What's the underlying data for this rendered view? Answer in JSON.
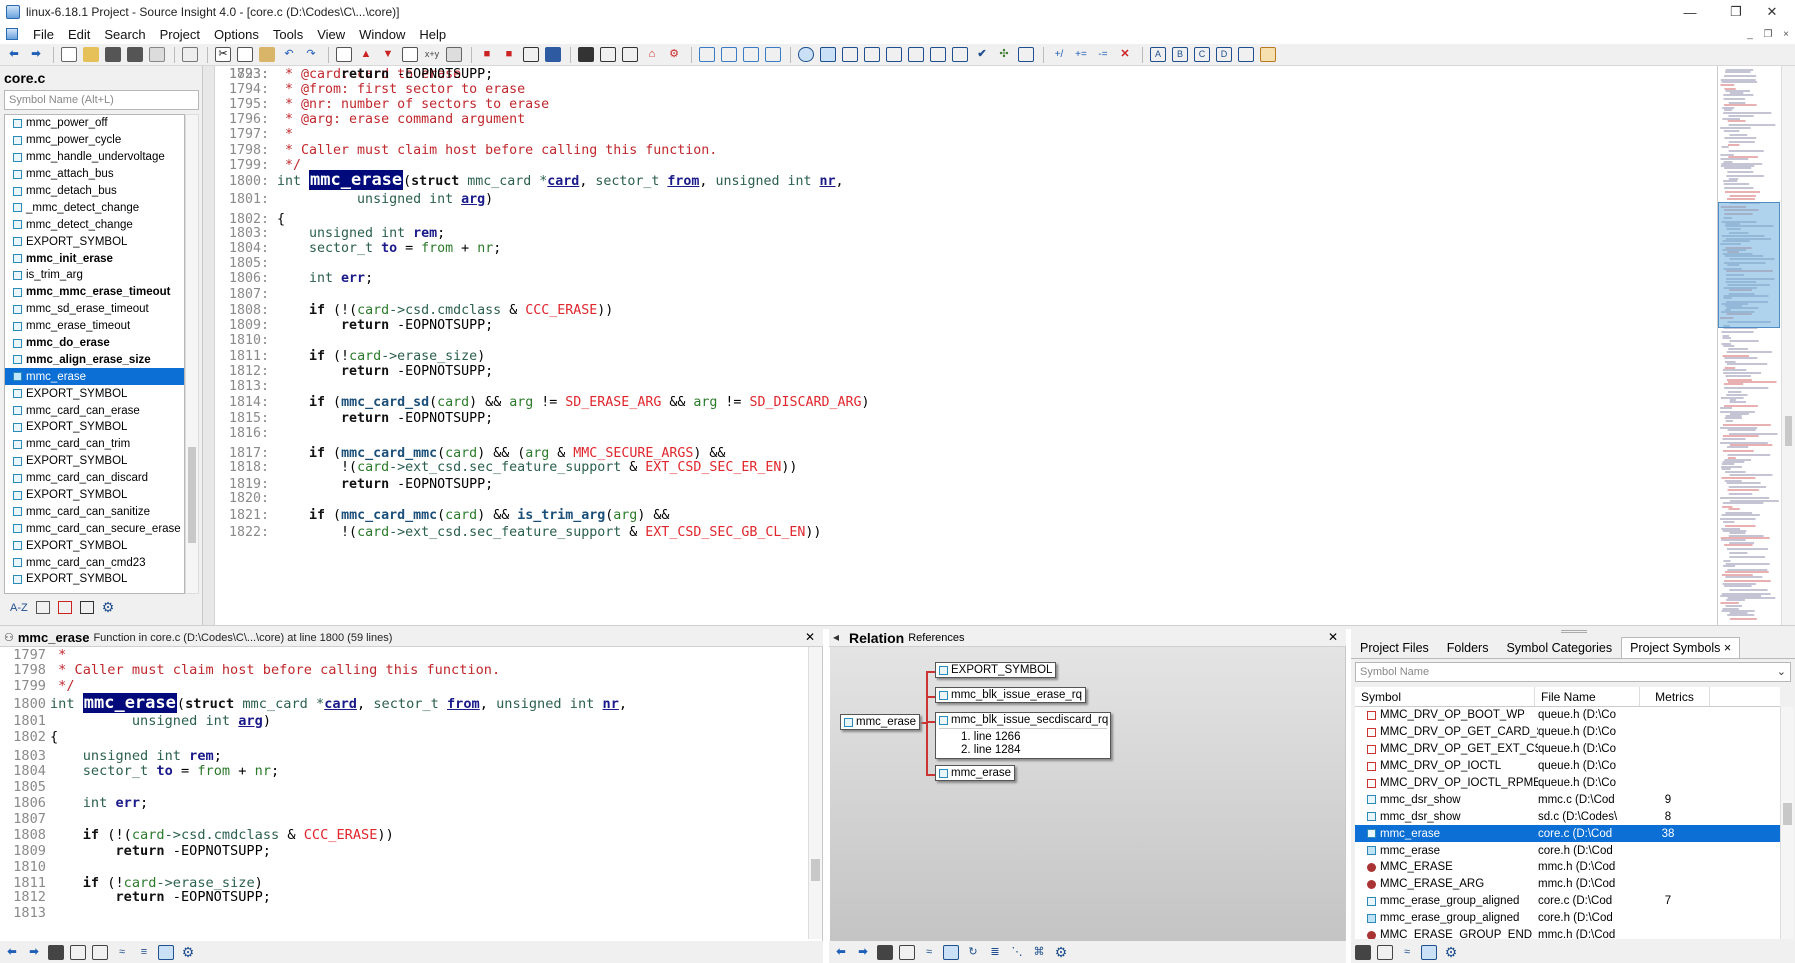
{
  "window": {
    "title": "linux-6.18.1 Project - Source Insight 4.0 - [core.c (D:\\Codes\\C\\...\\core)]",
    "minimize": "—",
    "restore": "❐",
    "close": "✕"
  },
  "menu": [
    "File",
    "Edit",
    "Search",
    "Project",
    "Options",
    "Tools",
    "View",
    "Window",
    "Help"
  ],
  "menu_right": [
    "_",
    "❐",
    "×"
  ],
  "symbol_panel": {
    "file": "core.c",
    "search_placeholder": "Symbol Name (Alt+L)",
    "items": [
      {
        "label": "mmc_power_off",
        "bold": false
      },
      {
        "label": "mmc_power_cycle",
        "bold": false
      },
      {
        "label": "mmc_handle_undervoltage",
        "bold": false
      },
      {
        "label": "mmc_attach_bus",
        "bold": false
      },
      {
        "label": "mmc_detach_bus",
        "bold": false
      },
      {
        "label": "_mmc_detect_change",
        "bold": false
      },
      {
        "label": "mmc_detect_change",
        "bold": false
      },
      {
        "label": "EXPORT_SYMBOL",
        "bold": false
      },
      {
        "label": "mmc_init_erase",
        "bold": true
      },
      {
        "label": "is_trim_arg",
        "bold": false
      },
      {
        "label": "mmc_mmc_erase_timeout",
        "bold": true
      },
      {
        "label": "mmc_sd_erase_timeout",
        "bold": false
      },
      {
        "label": "mmc_erase_timeout",
        "bold": false
      },
      {
        "label": "mmc_do_erase",
        "bold": true
      },
      {
        "label": "mmc_align_erase_size",
        "bold": true
      },
      {
        "label": "mmc_erase",
        "bold": false,
        "selected": true
      },
      {
        "label": "EXPORT_SYMBOL",
        "bold": false
      },
      {
        "label": "mmc_card_can_erase",
        "bold": false
      },
      {
        "label": "EXPORT_SYMBOL",
        "bold": false
      },
      {
        "label": "mmc_card_can_trim",
        "bold": false
      },
      {
        "label": "EXPORT_SYMBOL",
        "bold": false
      },
      {
        "label": "mmc_card_can_discard",
        "bold": false
      },
      {
        "label": "EXPORT_SYMBOL",
        "bold": false
      },
      {
        "label": "mmc_card_can_sanitize",
        "bold": false
      },
      {
        "label": "mmc_card_can_secure_erase",
        "bold": false
      },
      {
        "label": "EXPORT_SYMBOL",
        "bold": false
      },
      {
        "label": "mmc_card_can_cmd23",
        "bold": false
      },
      {
        "label": "EXPORT_SYMBOL",
        "bold": false
      }
    ],
    "footer_icons": [
      "sort-az-icon",
      "list-icon",
      "category-icon",
      "book-icon",
      "gear-icon"
    ]
  },
  "editor": {
    "lines": [
      {
        "n": "1793:",
        "segs": [
          [
            "cm",
            " * @card: card to erase"
          ]
        ]
      },
      {
        "n": "1794:",
        "segs": [
          [
            "cm",
            " * @from: first sector to erase"
          ]
        ]
      },
      {
        "n": "1795:",
        "segs": [
          [
            "cm",
            " * @nr: number of sectors to erase"
          ]
        ]
      },
      {
        "n": "1796:",
        "segs": [
          [
            "cm",
            " * @arg: erase command argument"
          ]
        ]
      },
      {
        "n": "1797:",
        "segs": [
          [
            "cm",
            " *"
          ]
        ]
      },
      {
        "n": "1798:",
        "segs": [
          [
            "cm",
            " * Caller must claim host before calling this function."
          ]
        ]
      },
      {
        "n": "1799:",
        "segs": [
          [
            "cm",
            " */"
          ]
        ]
      },
      {
        "n": "1800:",
        "segs": [
          [
            "ty",
            "int "
          ],
          [
            "hl",
            "mmc_erase"
          ],
          [
            "",
            "("
          ],
          [
            "kw",
            "struct"
          ],
          [
            "ty",
            " mmc_card *"
          ],
          [
            "pn",
            "card"
          ],
          [
            "",
            ", "
          ],
          [
            "ty",
            "sector_t "
          ],
          [
            "pn",
            "from"
          ],
          [
            "",
            ", "
          ],
          [
            "ty",
            "unsigned int "
          ],
          [
            "pn",
            "nr"
          ],
          [
            "",
            ","
          ]
        ]
      },
      {
        "n": "1801:",
        "segs": [
          [
            "ty",
            "          unsigned int "
          ],
          [
            "pn",
            "arg"
          ],
          [
            "",
            ")"
          ]
        ]
      },
      {
        "n": "1802:",
        "segs": [
          [
            "",
            "{"
          ]
        ]
      },
      {
        "n": "1803:",
        "segs": [
          [
            "ty",
            "    unsigned int "
          ],
          [
            "vn",
            "rem"
          ],
          [
            "",
            ";"
          ]
        ]
      },
      {
        "n": "1804:",
        "segs": [
          [
            "ty",
            "    sector_t "
          ],
          [
            "vn",
            "to"
          ],
          [
            "",
            " = "
          ],
          [
            "gv",
            "from"
          ],
          [
            "",
            " + "
          ],
          [
            "gv",
            "nr"
          ],
          [
            "",
            ";"
          ]
        ]
      },
      {
        "n": "1805:",
        "segs": [
          [
            "",
            ""
          ]
        ]
      },
      {
        "n": "1806:",
        "segs": [
          [
            "ty",
            "    int "
          ],
          [
            "vn",
            "err"
          ],
          [
            "",
            ";"
          ]
        ]
      },
      {
        "n": "1807:",
        "segs": [
          [
            "",
            ""
          ]
        ]
      },
      {
        "n": "1808:",
        "segs": [
          [
            "kw",
            "    if"
          ],
          [
            "",
            " (!("
          ],
          [
            "gv",
            "card"
          ],
          [
            "ty",
            "->csd.cmdclass"
          ],
          [
            "",
            " & "
          ],
          [
            "rd",
            "CCC_ERASE"
          ],
          [
            "",
            "))"
          ]
        ]
      },
      {
        "n": "1809:",
        "segs": [
          [
            "kw",
            "        return"
          ],
          [
            "",
            " -EOPNOTSUPP;"
          ]
        ]
      },
      {
        "n": "1810:",
        "segs": [
          [
            "",
            ""
          ]
        ]
      },
      {
        "n": "1811:",
        "segs": [
          [
            "kw",
            "    if"
          ],
          [
            "",
            " (!"
          ],
          [
            "gv",
            "card"
          ],
          [
            "ty",
            "->erase_size"
          ],
          [
            "",
            ")"
          ]
        ]
      },
      {
        "n": "1812:",
        "segs": [
          [
            "kw",
            "        return"
          ],
          [
            "",
            " -EOPNOTSUPP;"
          ]
        ]
      },
      {
        "n": "1813:",
        "segs": [
          [
            "",
            ""
          ]
        ]
      },
      {
        "n": "1814:",
        "segs": [
          [
            "kw",
            "    if"
          ],
          [
            "",
            " ("
          ],
          [
            "fn",
            "mmc_card_sd"
          ],
          [
            "",
            "("
          ],
          [
            "gv",
            "card"
          ],
          [
            "",
            ") && "
          ],
          [
            "gv",
            "arg"
          ],
          [
            "",
            " != "
          ],
          [
            "rd",
            "SD_ERASE_ARG"
          ],
          [
            "",
            " && "
          ],
          [
            "gv",
            "arg"
          ],
          [
            "",
            " != "
          ],
          [
            "rd",
            "SD_DISCARD_ARG"
          ],
          [
            "",
            ")"
          ]
        ]
      },
      {
        "n": "1815:",
        "segs": [
          [
            "kw",
            "        return"
          ],
          [
            "",
            " -EOPNOTSUPP;"
          ]
        ]
      },
      {
        "n": "1816:",
        "segs": [
          [
            "",
            ""
          ]
        ]
      },
      {
        "n": "1817:",
        "segs": [
          [
            "kw",
            "    if"
          ],
          [
            "",
            " ("
          ],
          [
            "fn",
            "mmc_card_mmc"
          ],
          [
            "",
            "("
          ],
          [
            "gv",
            "card"
          ],
          [
            "",
            ") && ("
          ],
          [
            "gv",
            "arg"
          ],
          [
            "",
            " & "
          ],
          [
            "rd",
            "MMC_SECURE_ARGS"
          ],
          [
            "",
            ") &&"
          ]
        ]
      },
      {
        "n": "1818:",
        "segs": [
          [
            "",
            "        !("
          ],
          [
            "gv",
            "card"
          ],
          [
            "ty",
            "->ext_csd.sec_feature_support"
          ],
          [
            "",
            " & "
          ],
          [
            "rd",
            "EXT_CSD_SEC_ER_EN"
          ],
          [
            "",
            "))"
          ]
        ]
      },
      {
        "n": "1819:",
        "segs": [
          [
            "kw",
            "        return"
          ],
          [
            "",
            " -EOPNOTSUPP;"
          ]
        ]
      },
      {
        "n": "1820:",
        "segs": [
          [
            "",
            ""
          ]
        ]
      },
      {
        "n": "1821:",
        "segs": [
          [
            "kw",
            "    if"
          ],
          [
            "",
            " ("
          ],
          [
            "fn",
            "mmc_card_mmc"
          ],
          [
            "",
            "("
          ],
          [
            "gv",
            "card"
          ],
          [
            "",
            ") && "
          ],
          [
            "fn",
            "is_trim_arg"
          ],
          [
            "",
            "("
          ],
          [
            "gv",
            "arg"
          ],
          [
            "",
            ") &&"
          ]
        ]
      },
      {
        "n": "1822:",
        "segs": [
          [
            "",
            "        !("
          ],
          [
            "gv",
            "card"
          ],
          [
            "ty",
            "->ext_csd.sec_feature_support"
          ],
          [
            "",
            " & "
          ],
          [
            "rd",
            "EXT_CSD_SEC_GB_CL_EN"
          ],
          [
            "",
            "))"
          ]
        ]
      },
      {
        "n": "1823:",
        "segs": [
          [
            "kw",
            "        return"
          ],
          [
            "",
            " -EOPNOTSUPP;"
          ]
        ]
      }
    ]
  },
  "context": {
    "symbol": "mmc_erase",
    "description": "Function in core.c (D:\\Codes\\C\\...\\core) at line 1800 (59 lines)",
    "close": "✕",
    "lines": [
      {
        "n": "1797",
        "segs": [
          [
            "cm",
            " *"
          ]
        ]
      },
      {
        "n": "1798",
        "segs": [
          [
            "cm",
            " * Caller must claim host before calling this function."
          ]
        ]
      },
      {
        "n": "1799",
        "segs": [
          [
            "cm",
            " */"
          ]
        ]
      },
      {
        "n": "1800",
        "segs": [
          [
            "ty",
            "int "
          ],
          [
            "hl",
            "mmc_erase"
          ],
          [
            "",
            "("
          ],
          [
            "kw",
            "struct"
          ],
          [
            "ty",
            " mmc_card *"
          ],
          [
            "pn",
            "card"
          ],
          [
            "",
            ", "
          ],
          [
            "ty",
            "sector_t "
          ],
          [
            "pn",
            "from"
          ],
          [
            "",
            ", "
          ],
          [
            "ty",
            "unsigned int "
          ],
          [
            "pn",
            "nr"
          ],
          [
            "",
            ","
          ]
        ]
      },
      {
        "n": "1801",
        "segs": [
          [
            "ty",
            "          unsigned int "
          ],
          [
            "pn",
            "arg"
          ],
          [
            "",
            ")"
          ]
        ]
      },
      {
        "n": "1802",
        "segs": [
          [
            "",
            "{"
          ]
        ]
      },
      {
        "n": "1803",
        "segs": [
          [
            "ty",
            "    unsigned int "
          ],
          [
            "vn",
            "rem"
          ],
          [
            "",
            ";"
          ]
        ]
      },
      {
        "n": "1804",
        "segs": [
          [
            "ty",
            "    sector_t "
          ],
          [
            "vn",
            "to"
          ],
          [
            "",
            " = "
          ],
          [
            "gv",
            "from"
          ],
          [
            "",
            " + "
          ],
          [
            "gv",
            "nr"
          ],
          [
            "",
            ";"
          ]
        ]
      },
      {
        "n": "1805",
        "segs": [
          [
            "",
            ""
          ]
        ]
      },
      {
        "n": "1806",
        "segs": [
          [
            "ty",
            "    int "
          ],
          [
            "vn",
            "err"
          ],
          [
            "",
            ";"
          ]
        ]
      },
      {
        "n": "1807",
        "segs": [
          [
            "",
            ""
          ]
        ]
      },
      {
        "n": "1808",
        "segs": [
          [
            "kw",
            "    if"
          ],
          [
            "",
            " (!("
          ],
          [
            "gv",
            "card"
          ],
          [
            "ty",
            "->csd.cmdclass"
          ],
          [
            "",
            " & "
          ],
          [
            "rd",
            "CCC_ERASE"
          ],
          [
            "",
            "))"
          ]
        ]
      },
      {
        "n": "1809",
        "segs": [
          [
            "kw",
            "        return"
          ],
          [
            "",
            " -EOPNOTSUPP;"
          ]
        ]
      },
      {
        "n": "1810",
        "segs": [
          [
            "",
            ""
          ]
        ]
      },
      {
        "n": "1811",
        "segs": [
          [
            "kw",
            "    if"
          ],
          [
            "",
            " (!"
          ],
          [
            "gv",
            "card"
          ],
          [
            "ty",
            "->erase_size"
          ],
          [
            "",
            ")"
          ]
        ]
      },
      {
        "n": "1812",
        "segs": [
          [
            "kw",
            "        return"
          ],
          [
            "",
            " -EOPNOTSUPP;"
          ]
        ]
      },
      {
        "n": "1813",
        "segs": [
          [
            "",
            ""
          ]
        ]
      }
    ]
  },
  "relation": {
    "title": "Relation",
    "subtitle": "References",
    "close": "✕",
    "root": "mmc_erase",
    "children": [
      {
        "label": "EXPORT_SYMBOL"
      },
      {
        "label": "mmc_blk_issue_erase_rq"
      },
      {
        "label": "mmc_blk_issue_secdiscard_rq",
        "refs": [
          "1. line 1266",
          "2. line 1284"
        ]
      },
      {
        "label": "mmc_erase"
      }
    ]
  },
  "project": {
    "tabs": [
      "Project Files",
      "Folders",
      "Symbol Categories",
      "Project Symbols ×"
    ],
    "active_tab": 3,
    "search_placeholder": "Symbol Name",
    "columns": [
      "Symbol",
      "File Name",
      "Metrics"
    ],
    "rows": [
      {
        "icon": "macro-icon",
        "symbol": "MMC_DRV_OP_BOOT_WP",
        "file": "queue.h (D:\\Co",
        "metrics": ""
      },
      {
        "icon": "macro-icon",
        "symbol": "MMC_DRV_OP_GET_CARD_S",
        "file": "queue.h (D:\\Co",
        "metrics": ""
      },
      {
        "icon": "macro-icon",
        "symbol": "MMC_DRV_OP_GET_EXT_CS",
        "file": "queue.h (D:\\Co",
        "metrics": ""
      },
      {
        "icon": "macro-icon",
        "symbol": "MMC_DRV_OP_IOCTL",
        "file": "queue.h (D:\\Co",
        "metrics": ""
      },
      {
        "icon": "macro-icon",
        "symbol": "MMC_DRV_OP_IOCTL_RPMB",
        "file": "queue.h (D:\\Co",
        "metrics": ""
      },
      {
        "icon": "function-icon",
        "symbol": "mmc_dsr_show",
        "file": "mmc.c (D:\\Cod",
        "metrics": "9"
      },
      {
        "icon": "function-icon",
        "symbol": "mmc_dsr_show",
        "file": "sd.c (D:\\Codes\\",
        "metrics": "8"
      },
      {
        "icon": "function-icon",
        "symbol": "mmc_erase",
        "file": "core.c (D:\\Cod",
        "metrics": "38",
        "selected": true
      },
      {
        "icon": "prototype-icon",
        "symbol": "mmc_erase",
        "file": "core.h (D:\\Cod",
        "metrics": ""
      },
      {
        "icon": "define-icon",
        "symbol": "MMC_ERASE",
        "file": "mmc.h (D:\\Cod",
        "metrics": ""
      },
      {
        "icon": "define-icon",
        "symbol": "MMC_ERASE_ARG",
        "file": "mmc.h (D:\\Cod",
        "metrics": ""
      },
      {
        "icon": "function-icon",
        "symbol": "mmc_erase_group_aligned",
        "file": "core.c (D:\\Cod",
        "metrics": "7"
      },
      {
        "icon": "prototype-icon",
        "symbol": "mmc_erase_group_aligned",
        "file": "core.h (D:\\Cod",
        "metrics": ""
      },
      {
        "icon": "define-icon",
        "symbol": "MMC_ERASE_GROUP_END",
        "file": "mmc.h (D:\\Cod",
        "metrics": ""
      }
    ]
  },
  "colors": {
    "selection": "#0b6fd6",
    "comment": "#c0282d",
    "highlight": "#000a7a"
  }
}
